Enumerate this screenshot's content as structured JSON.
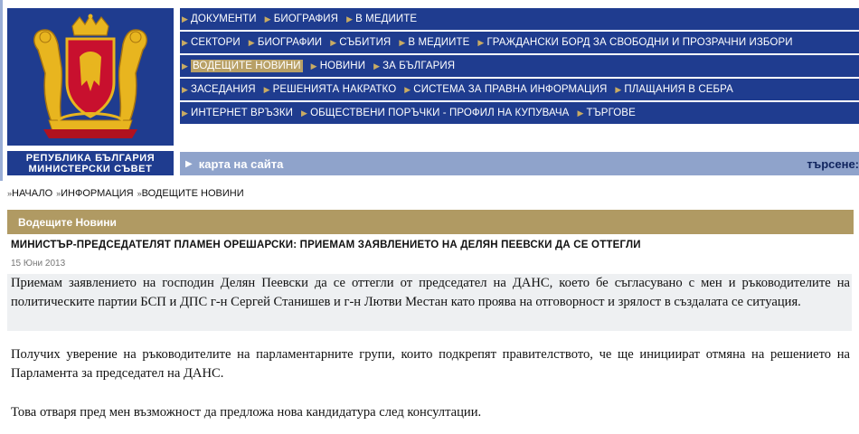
{
  "logo": {
    "line1": "РЕПУБЛИКА БЪЛГАРИЯ",
    "line2": "МИНИСТЕРСКИ СЪВЕТ"
  },
  "nav": {
    "rows": [
      [
        "ДОКУМЕНТИ",
        "БИОГРАФИЯ",
        "В МЕДИИТЕ"
      ],
      [
        "СЕКТОРИ",
        "БИОГРАФИИ",
        "СЪБИТИЯ",
        "В МЕДИИТЕ",
        "ГРАЖДАНСКИ БОРД ЗА СВОБОДНИ И ПРОЗРАЧНИ ИЗБОРИ"
      ],
      [
        "ВОДЕЩИТЕ НОВИНИ",
        "НОВИНИ",
        "ЗА БЪЛГАРИЯ"
      ],
      [
        "ЗАСЕДАНИЯ",
        "РЕШЕНИЯТА НАКРАТКО",
        "СИСТЕМА ЗА ПРАВНА ИНФОРМАЦИЯ",
        "ПЛАЩАНИЯ В СЕБРА"
      ],
      [
        "ИНТЕРНЕТ ВРЪЗКИ",
        "ОБЩЕСТВЕНИ ПОРЪЧКИ - ПРОФИЛ НА КУПУВАЧА",
        "ТЪРГОВЕ"
      ]
    ],
    "active": "ВОДЕЩИТЕ НОВИНИ"
  },
  "sitebar": {
    "map_label": "карта на сайта",
    "search_label": "търсене:"
  },
  "breadcrumb": [
    "НАЧАЛО",
    "ИНФОРМАЦИЯ",
    "ВОДЕЩИТЕ НОВИНИ"
  ],
  "section": {
    "title": "Водещите Новини"
  },
  "article": {
    "title": "МИНИСТЪР-ПРЕДСЕДАТЕЛЯТ ПЛАМЕН ОРЕШАРСКИ: ПРИЕМАМ ЗАЯВЛЕНИЕТО НА ДЕЛЯН ПЕЕВСКИ ДА СЕ ОТТЕГЛИ",
    "date": "15 Юни 2013",
    "paragraphs": [
      "Приемам заявлението на господин Делян Пеевски да се оттегли от председател на ДАНС, което бе съгласувано с мен и ръководителите на политическите партии БСП и ДПС г-н Сергей Станишев и г-н Лютви Местан като проява на отговорност и зрялост в създалата се ситуация.",
      "Получих уверение на ръководителите на парламентарните групи, които подкрепят правителството, че ще инициират отмяна на решението на Парламента за председател на ДАНС.",
      "Това отваря пред мен възможност да предложа нова кандидатура след консултации."
    ]
  },
  "colors": {
    "nav_blue": "#1f3c8f",
    "gold": "#b09a63",
    "sitebar": "#8fa3cb"
  }
}
